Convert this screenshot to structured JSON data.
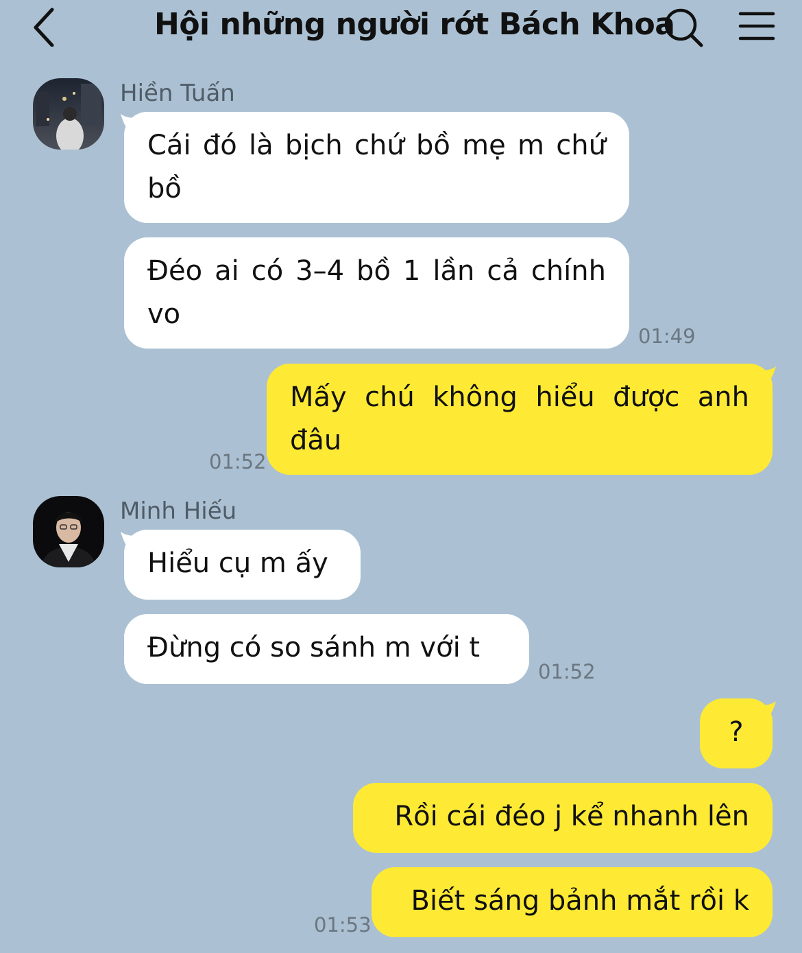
{
  "header": {
    "title": "Hội những người rớt Bách Khoa",
    "back_icon": "chevron-left-icon",
    "search_icon": "search-icon",
    "menu_icon": "hamburger-menu-icon"
  },
  "colors": {
    "background": "#abc1d3",
    "incoming_bubble": "#ffffff",
    "outgoing_bubble": "#fee934",
    "timestamp": "#6b7680"
  },
  "messages": [
    {
      "sender": "Hiền Tuấn",
      "direction": "incoming",
      "bubbles": [
        "Cái đó là bịch chứ bồ mẹ m chứ bồ",
        "Đéo ai có 3–4 bồ 1 lần cả chính vo"
      ],
      "time": "01:49"
    },
    {
      "direction": "outgoing",
      "bubbles": [
        "Mấy chú không hiểu được anh đâu"
      ],
      "time": "01:52"
    },
    {
      "sender": "Minh Hiếu",
      "direction": "incoming",
      "bubbles": [
        "Hiểu cụ m ấy",
        "Đừng có so sánh m với t"
      ],
      "time": "01:52"
    },
    {
      "direction": "outgoing",
      "bubbles": [
        "?",
        "Rồi cái đéo j kể nhanh lên",
        "Biết sáng bảnh mắt rồi k"
      ],
      "time": "01:53"
    }
  ]
}
